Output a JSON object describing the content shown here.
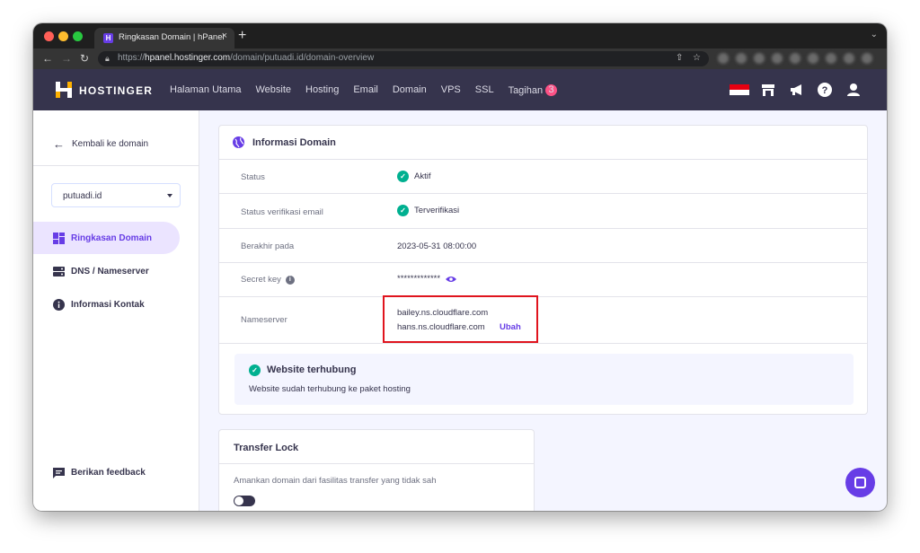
{
  "browser": {
    "tab_title": "Ringkasan Domain | hPanel",
    "tab_close": "×",
    "new_tab": "+",
    "url_prefix": "https://",
    "url_host": "hpanel.hostinger.com",
    "url_path": "/domain/putuadi.id/domain-overview"
  },
  "header": {
    "brand": "HOSTINGER",
    "nav": [
      "Halaman Utama",
      "Website",
      "Hosting",
      "Email",
      "Domain",
      "VPS",
      "SSL",
      "Tagihan"
    ],
    "billing_badge": "3"
  },
  "sidebar": {
    "back_label": "Kembali ke domain",
    "domain_select": "putuadi.id",
    "items": [
      {
        "label": "Ringkasan Domain",
        "icon": "dashboard-icon",
        "active": true
      },
      {
        "label": "DNS / Nameserver",
        "icon": "server-icon",
        "active": false
      },
      {
        "label": "Informasi Kontak",
        "icon": "info-icon",
        "active": false
      }
    ],
    "feedback_label": "Berikan feedback"
  },
  "domain_info": {
    "title": "Informasi Domain",
    "rows": {
      "status_label": "Status",
      "status_value": "Aktif",
      "email_verify_label": "Status verifikasi email",
      "email_verify_value": "Terverifikasi",
      "expires_label": "Berakhir pada",
      "expires_value": "2023-05-31 08:00:00",
      "secret_label": "Secret key",
      "secret_value": "*************",
      "nameserver_label": "Nameserver",
      "nameservers": [
        "bailey.ns.cloudflare.com",
        "hans.ns.cloudflare.com"
      ],
      "change_label": "Ubah"
    },
    "alert_title": "Website terhubung",
    "alert_text": "Website sudah terhubung ke paket hosting"
  },
  "transfer_lock": {
    "title": "Transfer Lock",
    "description": "Amankan domain dari fasilitas transfer yang tidak sah",
    "enabled": false
  },
  "colors": {
    "brand_purple": "#673de6",
    "header_bg": "#36344d",
    "success": "#00b090",
    "highlight_red": "#e0141e"
  }
}
